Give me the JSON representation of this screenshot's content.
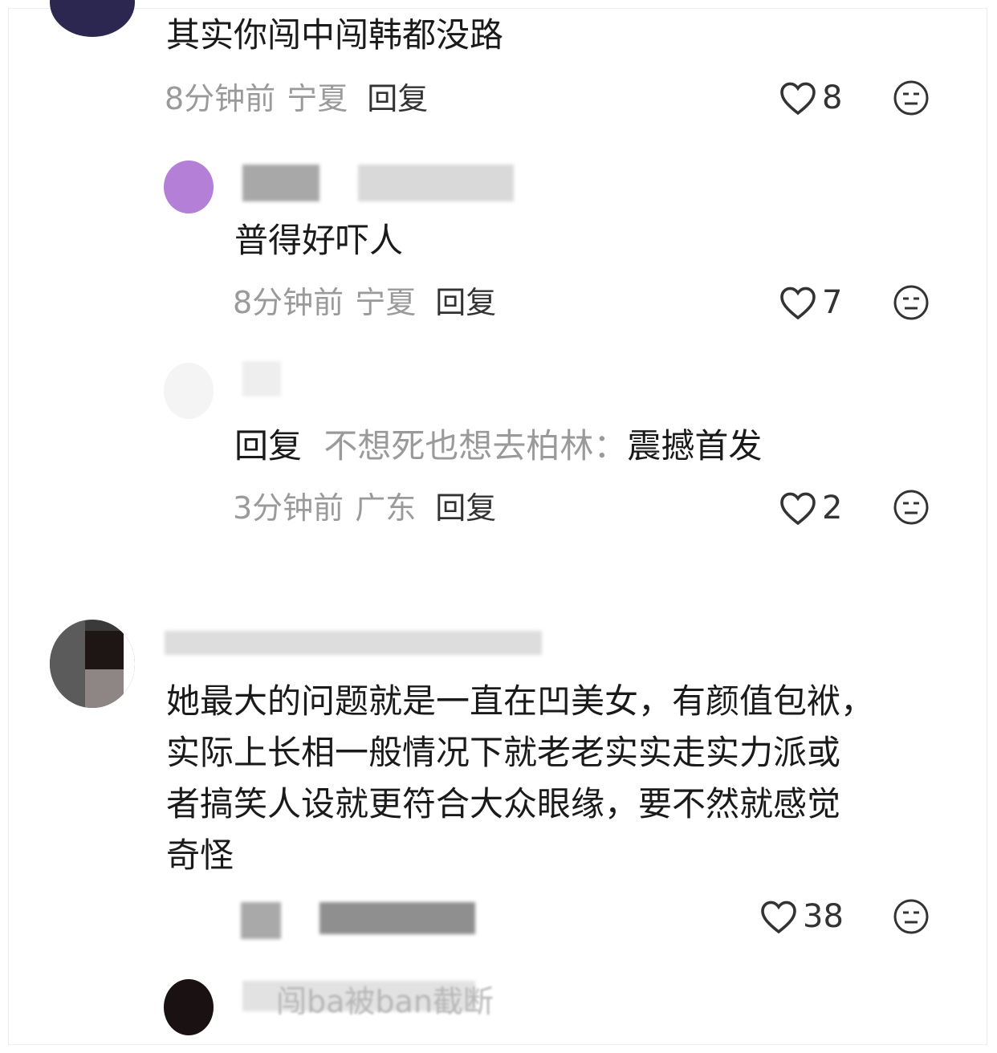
{
  "comments": [
    {
      "text": "其实你闯中闯韩都没路",
      "time": "8分钟前",
      "location": "宁夏",
      "reply_label": "回复",
      "likes": "8"
    },
    {
      "text": "普得好吓人",
      "time": "8分钟前",
      "location": "宁夏",
      "reply_label": "回复",
      "likes": "7"
    },
    {
      "reply_prefix": "回复",
      "reply_target": "不想死也想去柏林：",
      "text": "震撼首发",
      "time": "3分钟前",
      "location": "广东",
      "reply_label": "回复",
      "likes": "2"
    },
    {
      "lines": [
        "她最大的问题就是一直在凹美女，有颜值包袱，",
        "实际上长相一般情况下就老老实实走实力派或",
        "者搞笑人设就更符合大众眼缘，要不然就感觉",
        "奇怪"
      ],
      "likes": "38"
    },
    {
      "partial_username": "闯ba被ban截断"
    }
  ],
  "colors": {
    "text": "#1a1a1a",
    "meta": "#9a9a9a",
    "icon": "#333333"
  },
  "icons": [
    "heart-icon",
    "dislike-face-icon"
  ]
}
